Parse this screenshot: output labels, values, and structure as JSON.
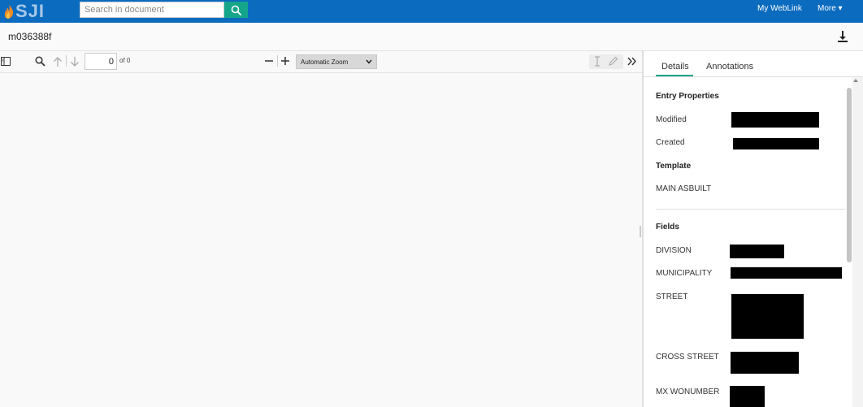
{
  "app": {
    "logo_text": "SJI",
    "brand_color": "#0b6bbf",
    "accent_color": "#15a58a"
  },
  "header": {
    "search_placeholder": "Search in document",
    "search_icon": "search-icon",
    "nav": [
      "My WebLink",
      "More ▾"
    ]
  },
  "document": {
    "title": "m036388f",
    "download_icon": "download-icon"
  },
  "toolbar": {
    "page_value": "0",
    "page_of": "of 0",
    "zoom": "Automatic Zoom",
    "icons": [
      "sidebar-toggle-icon",
      "find-icon",
      "previous-page-icon",
      "next-page-icon",
      "zoom-out-icon",
      "zoom-in-icon",
      "text-select-icon",
      "draw-icon",
      "more-tools-icon"
    ]
  },
  "panel": {
    "tabs": [
      "Details",
      "Annotations"
    ],
    "active_tab": "Details",
    "entry_properties_heading": "Entry Properties",
    "modified_label": "Modified",
    "created_label": "Created",
    "template_heading": "Template",
    "template_value": "MAIN ASBUILT",
    "fields_heading": "Fields",
    "fields": [
      "DIVISION",
      "MUNICIPALITY",
      "STREET",
      "CROSS STREET",
      "MX WONUMBER"
    ]
  }
}
